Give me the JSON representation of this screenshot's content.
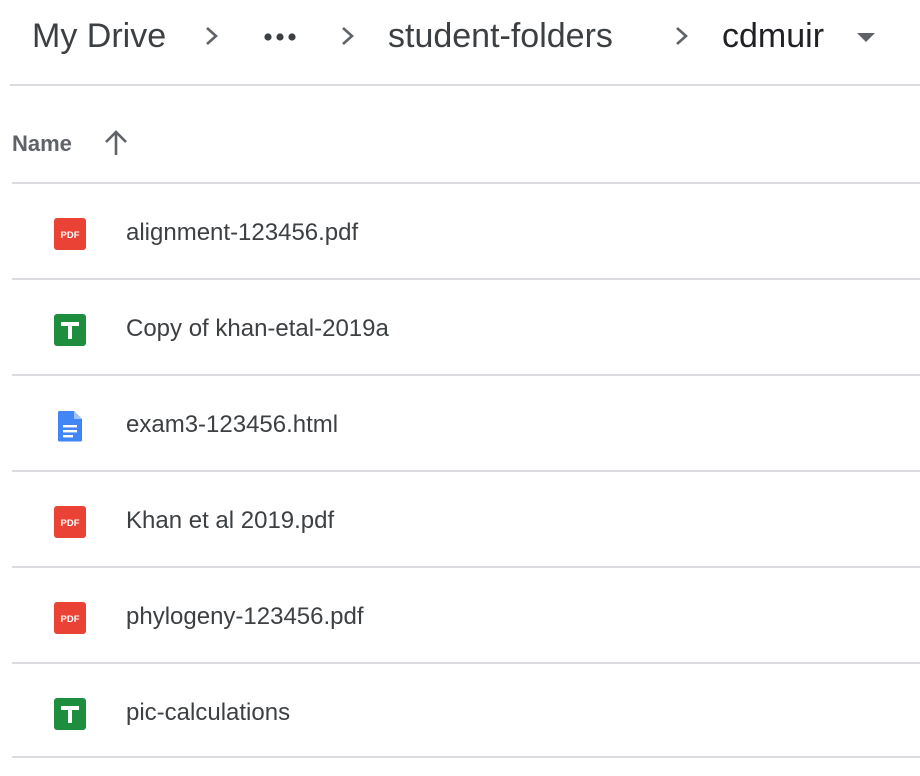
{
  "breadcrumb": {
    "root": "My Drive",
    "ellipsis": "•••",
    "parent": "student-folders",
    "current": "cdmuir"
  },
  "header": {
    "name_label": "Name",
    "sort": "ascending"
  },
  "files": [
    {
      "name": "alignment-123456.pdf",
      "type": "pdf",
      "icon": "pdf-icon",
      "color": "#ea4335"
    },
    {
      "name": "Copy of khan-etal-2019a",
      "type": "sheets",
      "icon": "sheets-icon",
      "color": "#1e8e3e"
    },
    {
      "name": "exam3-123456.html",
      "type": "docs",
      "icon": "docs-icon",
      "color": "#4285f4"
    },
    {
      "name": "Khan et al 2019.pdf",
      "type": "pdf",
      "icon": "pdf-icon",
      "color": "#ea4335"
    },
    {
      "name": "phylogeny-123456.pdf",
      "type": "pdf",
      "icon": "pdf-icon",
      "color": "#ea4335"
    },
    {
      "name": "pic-calculations",
      "type": "sheets",
      "icon": "sheets-icon",
      "color": "#1e8e3e"
    }
  ],
  "colors": {
    "divider": "#dadce0",
    "text": "#3c4043",
    "header_text": "#5f6368"
  }
}
